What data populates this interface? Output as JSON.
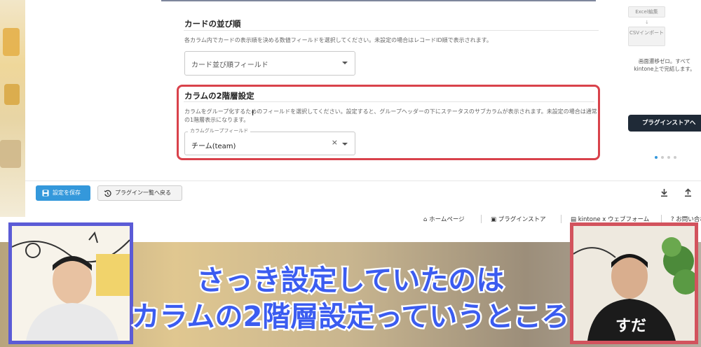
{
  "sort_section": {
    "title": "カードの並び順",
    "description": "各カラム内でカードの表示順を決める数値フィールドを選択してください。未設定の場合はレコードID順で表示されます。",
    "select_placeholder": "カード並び順フィールド"
  },
  "column_section": {
    "title": "カラムの2階層設定",
    "description_line1": "カラムをグループ化するためのフィールドを選択してください。設定すると、グループヘッダーの下にステータスのサブカラムが表示されます。未設定の場合は通常",
    "description_line2": "の1階層表示になります。",
    "field_label": "カラムグループフィールド",
    "field_value": "チーム(team)",
    "clear_icon": "×"
  },
  "right_panel": {
    "btn_excel": "Excel編集",
    "btn_csv": "CSVインポート",
    "arrow": "↓",
    "text": "画面遷移ゼロ。すべてkintone上で完結します。",
    "store_button": "プラグインストアへ",
    "carousel_dots": 4,
    "carousel_active": 1
  },
  "toolbar": {
    "save_label": "設定を保存",
    "back_label": "プラグイン一覧へ戻る"
  },
  "footer": {
    "links": [
      "ホームページ",
      "プラグインストア",
      "kintone x ウェブフォーム",
      "お問い合わせ"
    ]
  },
  "caption": {
    "line1": "さっき設定していたのは",
    "line2": "カラムの2階層設定っていうところ"
  },
  "colors": {
    "accent": "#3498db",
    "highlight_border": "#d9424b",
    "caption_text": "#3b5cf0",
    "left_frame": "#5b5bd6",
    "right_frame": "#d2535d"
  }
}
